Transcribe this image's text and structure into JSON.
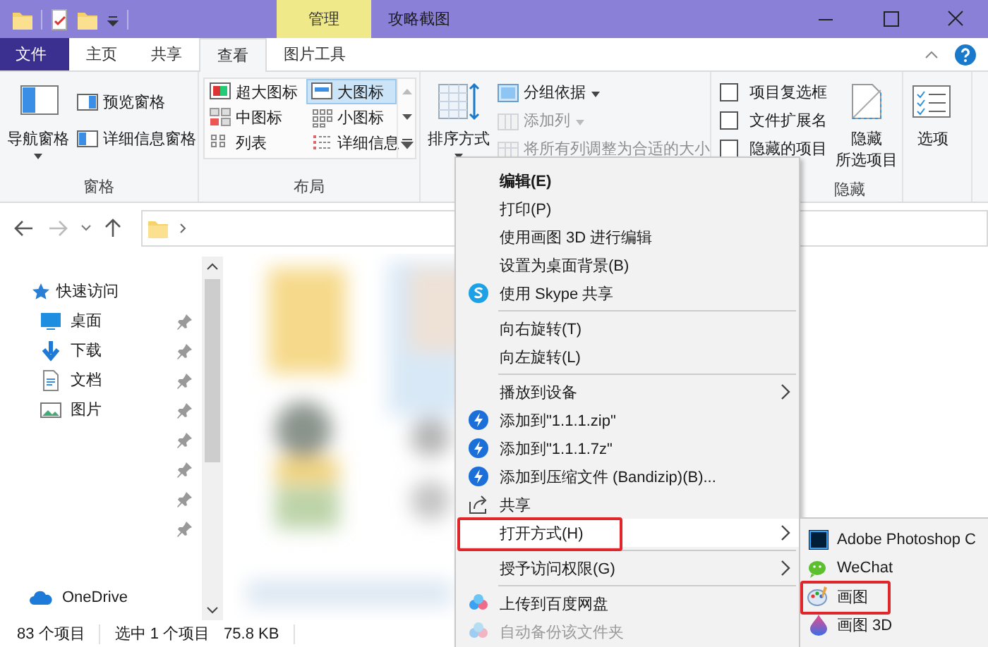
{
  "title_bar": {
    "context_tab": "管理",
    "title": "攻略截图"
  },
  "ribbon_tabs": [
    {
      "label": "文件",
      "kind": "file",
      "selected": false
    },
    {
      "label": "主页",
      "kind": "tab",
      "selected": false
    },
    {
      "label": "共享",
      "kind": "tab",
      "selected": false
    },
    {
      "label": "查看",
      "kind": "tab",
      "selected": true
    },
    {
      "label": "图片工具",
      "kind": "tab",
      "selected": false
    }
  ],
  "ribbon_groups": [
    {
      "label": "窗格",
      "sections": [
        {
          "kind": "large",
          "lines": [
            "导航窗格"
          ],
          "dropdown": true
        },
        {
          "kind": "stack",
          "items": [
            {
              "label": "预览窗格",
              "disabled": false,
              "dropdown": false
            },
            {
              "label": "详细信息窗格",
              "disabled": false,
              "dropdown": false
            }
          ]
        }
      ]
    },
    {
      "label": "布局",
      "sections": [
        {
          "kind": "gallery",
          "items": [
            {
              "label": "超大图标",
              "selected": false
            },
            {
              "label": "大图标",
              "selected": true
            },
            {
              "label": "中图标",
              "selected": false
            },
            {
              "label": "小图标",
              "selected": false
            },
            {
              "label": "列表",
              "selected": false
            },
            {
              "label": "详细信息",
              "selected": false
            }
          ]
        }
      ]
    },
    {
      "sections": [
        {
          "kind": "large",
          "lines": [
            "排序方式"
          ],
          "dropdown": true
        },
        {
          "kind": "stack",
          "items": [
            {
              "label": "分组依据",
              "disabled": false,
              "dropdown": true
            },
            {
              "label": "添加列",
              "disabled": true,
              "dropdown": true
            },
            {
              "label": "将所有列调整为合适的大小",
              "disabled": true,
              "dropdown": false
            }
          ]
        }
      ]
    },
    {
      "label": "隐藏",
      "sections": [
        {
          "kind": "checks",
          "items": [
            {
              "label": "项目复选框",
              "checked": false
            },
            {
              "label": "文件扩展名",
              "checked": false
            },
            {
              "label": "隐藏的项目",
              "checked": false
            }
          ]
        },
        {
          "kind": "large",
          "lines": [
            "隐藏",
            "所选项目"
          ],
          "dropdown": false
        }
      ]
    },
    {
      "sections": [
        {
          "kind": "large",
          "lines": [
            "选项"
          ],
          "dropdown": false
        }
      ]
    }
  ],
  "sidebar": {
    "items": [
      {
        "kind": "header",
        "label": "快速访问",
        "pinned": false
      },
      {
        "kind": "folder",
        "label": "桌面",
        "pinned": true
      },
      {
        "kind": "folder",
        "label": "下载",
        "pinned": true
      },
      {
        "kind": "folder",
        "label": "文档",
        "pinned": true
      },
      {
        "kind": "folder",
        "label": "图片",
        "pinned": true
      },
      {
        "kind": "blurred",
        "pinned": true
      },
      {
        "kind": "blurred",
        "pinned": true
      },
      {
        "kind": "blurred",
        "pinned": true
      },
      {
        "kind": "blurred",
        "pinned": true
      },
      {
        "kind": "drive",
        "label": "OneDrive",
        "pinned": false
      }
    ]
  },
  "status_bar": {
    "item_count": "83 个项目",
    "selection": "选中 1 个项目",
    "size": "75.8 KB"
  },
  "context_menu": {
    "items": [
      {
        "kind": "plain",
        "label": "编辑(E)",
        "default": true,
        "submenu": false,
        "highlighted": false,
        "marked": false,
        "disabled": false
      },
      {
        "kind": "plain",
        "label": "打印(P)",
        "default": false,
        "submenu": false,
        "highlighted": false,
        "marked": false,
        "disabled": false
      },
      {
        "kind": "plain",
        "label": "使用画图 3D 进行编辑",
        "default": false,
        "submenu": false,
        "highlighted": false,
        "marked": false,
        "disabled": false
      },
      {
        "kind": "plain",
        "label": "设置为桌面背景(B)",
        "default": false,
        "submenu": false,
        "highlighted": false,
        "marked": false,
        "disabled": false
      },
      {
        "kind": "skype",
        "label": "使用 Skype 共享",
        "default": false,
        "submenu": false,
        "highlighted": false,
        "marked": false,
        "disabled": false
      },
      {
        "kind": "separator"
      },
      {
        "kind": "plain",
        "label": "向右旋转(T)",
        "default": false,
        "submenu": false,
        "highlighted": false,
        "marked": false,
        "disabled": false
      },
      {
        "kind": "plain",
        "label": "向左旋转(L)",
        "default": false,
        "submenu": false,
        "highlighted": false,
        "marked": false,
        "disabled": false
      },
      {
        "kind": "separator"
      },
      {
        "kind": "plain",
        "label": "播放到设备",
        "default": false,
        "submenu": true,
        "highlighted": false,
        "marked": false,
        "disabled": false
      },
      {
        "kind": "bandizip",
        "label": "添加到\"1.1.1.zip\"",
        "default": false,
        "submenu": false,
        "highlighted": false,
        "marked": false,
        "disabled": false
      },
      {
        "kind": "bandizip",
        "label": "添加到\"1.1.1.7z\"",
        "default": false,
        "submenu": false,
        "highlighted": false,
        "marked": false,
        "disabled": false
      },
      {
        "kind": "bandizip",
        "label": "添加到压缩文件 (Bandizip)(B)...",
        "default": false,
        "submenu": false,
        "highlighted": false,
        "marked": false,
        "disabled": false
      },
      {
        "kind": "share",
        "label": "共享",
        "default": false,
        "submenu": false,
        "highlighted": false,
        "marked": false,
        "disabled": false
      },
      {
        "kind": "plain",
        "label": "打开方式(H)",
        "default": false,
        "submenu": true,
        "highlighted": true,
        "marked": true,
        "disabled": false
      },
      {
        "kind": "separator"
      },
      {
        "kind": "plain",
        "label": "授予访问权限(G)",
        "default": false,
        "submenu": true,
        "highlighted": false,
        "marked": false,
        "disabled": false
      },
      {
        "kind": "separator"
      },
      {
        "kind": "baidu",
        "label": "上传到百度网盘",
        "default": false,
        "submenu": false,
        "highlighted": false,
        "marked": false,
        "disabled": false
      },
      {
        "kind": "baidu",
        "label": "自动备份该文件夹",
        "default": false,
        "submenu": false,
        "highlighted": false,
        "marked": false,
        "disabled": true
      }
    ]
  },
  "open_with_menu": {
    "items": [
      {
        "kind": "photoshop",
        "label": "Adobe Photoshop C",
        "marked": false
      },
      {
        "kind": "wechat",
        "label": "WeChat",
        "marked": false
      },
      {
        "kind": "paint",
        "label": "画图",
        "marked": true
      },
      {
        "kind": "paint3d",
        "label": "画图 3D",
        "marked": false
      }
    ]
  }
}
